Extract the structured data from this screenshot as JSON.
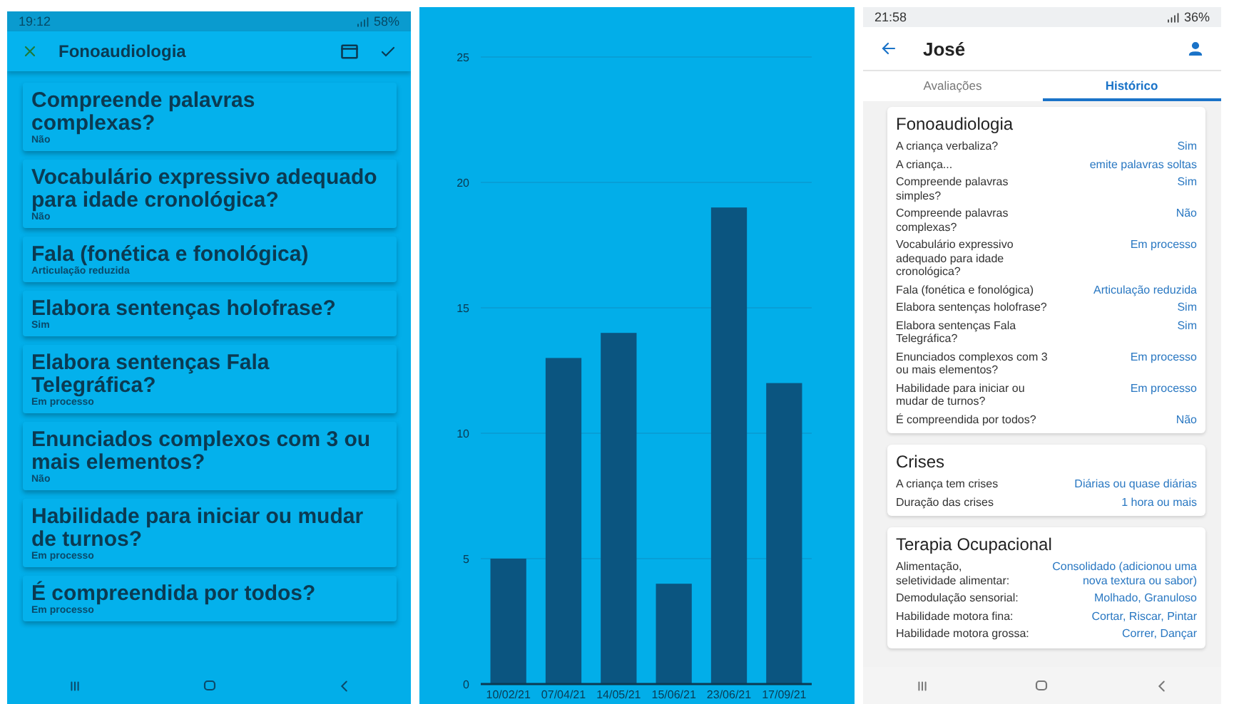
{
  "form_screen": {
    "status_bar": {
      "time": "19:12",
      "battery": "58%"
    },
    "header": {
      "title": "Fonoaudiologia"
    },
    "cards": [
      {
        "question": "Compreende palavras complexas?",
        "answer": "Não"
      },
      {
        "question": "Vocabulário expressivo adequado para idade cronológica?",
        "answer": "Não"
      },
      {
        "question": "Fala (fonética e fonológica)",
        "answer": "Articulação reduzida"
      },
      {
        "question": "Elabora sentenças holofrase?",
        "answer": "Sim"
      },
      {
        "question": "Elabora sentenças Fala Telegráfica?",
        "answer": "Em processo"
      },
      {
        "question": "Enunciados complexos com 3 ou mais elementos?",
        "answer": "Não"
      },
      {
        "question": "Habilidade para iniciar ou mudar de turnos?",
        "answer": "Em processo"
      },
      {
        "question": "É compreendida por todos?",
        "answer": "Em processo"
      }
    ]
  },
  "chart_screen": {
    "chart_data": {
      "type": "bar",
      "categories": [
        "10/02/21",
        "07/04/21",
        "14/05/21",
        "15/06/21",
        "23/06/21",
        "17/09/21"
      ],
      "values": [
        5,
        13,
        14,
        4,
        19,
        12
      ],
      "ylim": [
        0,
        25
      ],
      "grid": true,
      "yticks": [
        0,
        5,
        10,
        15,
        20,
        25
      ]
    }
  },
  "history_screen": {
    "status_bar": {
      "time": "21:58",
      "battery": "36%"
    },
    "header": {
      "title": "José"
    },
    "tabs": [
      {
        "label": "Avaliações",
        "selected": false
      },
      {
        "label": "Histórico",
        "selected": true
      }
    ],
    "sections": [
      {
        "title": "Fonoaudiologia",
        "rows": [
          {
            "label": "A criança verbaliza?",
            "value": "Sim"
          },
          {
            "label": "A criança...",
            "value": "emite palavras soltas"
          },
          {
            "label": "Compreende palavras simples?",
            "value": "Sim"
          },
          {
            "label": "Compreende palavras complexas?",
            "value": "Não"
          },
          {
            "label": "Vocabulário expressivo adequado para idade cronológica?",
            "value": "Em processo"
          },
          {
            "label": "Fala (fonética e fonológica)",
            "value": "Articulação reduzida"
          },
          {
            "label": "Elabora sentenças holofrase?",
            "value": "Sim"
          },
          {
            "label": "Elabora sentenças Fala Telegráfica?",
            "value": "Sim"
          },
          {
            "label": "Enunciados complexos com 3 ou mais elementos?",
            "value": "Em processo"
          },
          {
            "label": "Habilidade para iniciar ou mudar de turnos?",
            "value": "Em processo"
          },
          {
            "label": "É compreendida por todos?",
            "value": "Não"
          }
        ]
      },
      {
        "title": "Crises",
        "rows": [
          {
            "label": "A criança tem crises",
            "value": "Diárias ou quase diárias"
          },
          {
            "label": "Duração das crises",
            "value": "1 hora ou mais"
          }
        ]
      },
      {
        "title": "Terapia Ocupacional",
        "rows": [
          {
            "label": "Alimentação, seletividade alimentar:",
            "value": "Consolidado (adicionou uma nova textura ou sabor)"
          },
          {
            "label": "Demodulação sensorial:",
            "value": "Molhado, Granuloso"
          },
          {
            "label": "Habilidade motora fina:",
            "value": "Cortar, Riscar, Pintar"
          },
          {
            "label": "Habilidade motora grossa:",
            "value": "Correr, Dançar"
          }
        ]
      }
    ]
  }
}
